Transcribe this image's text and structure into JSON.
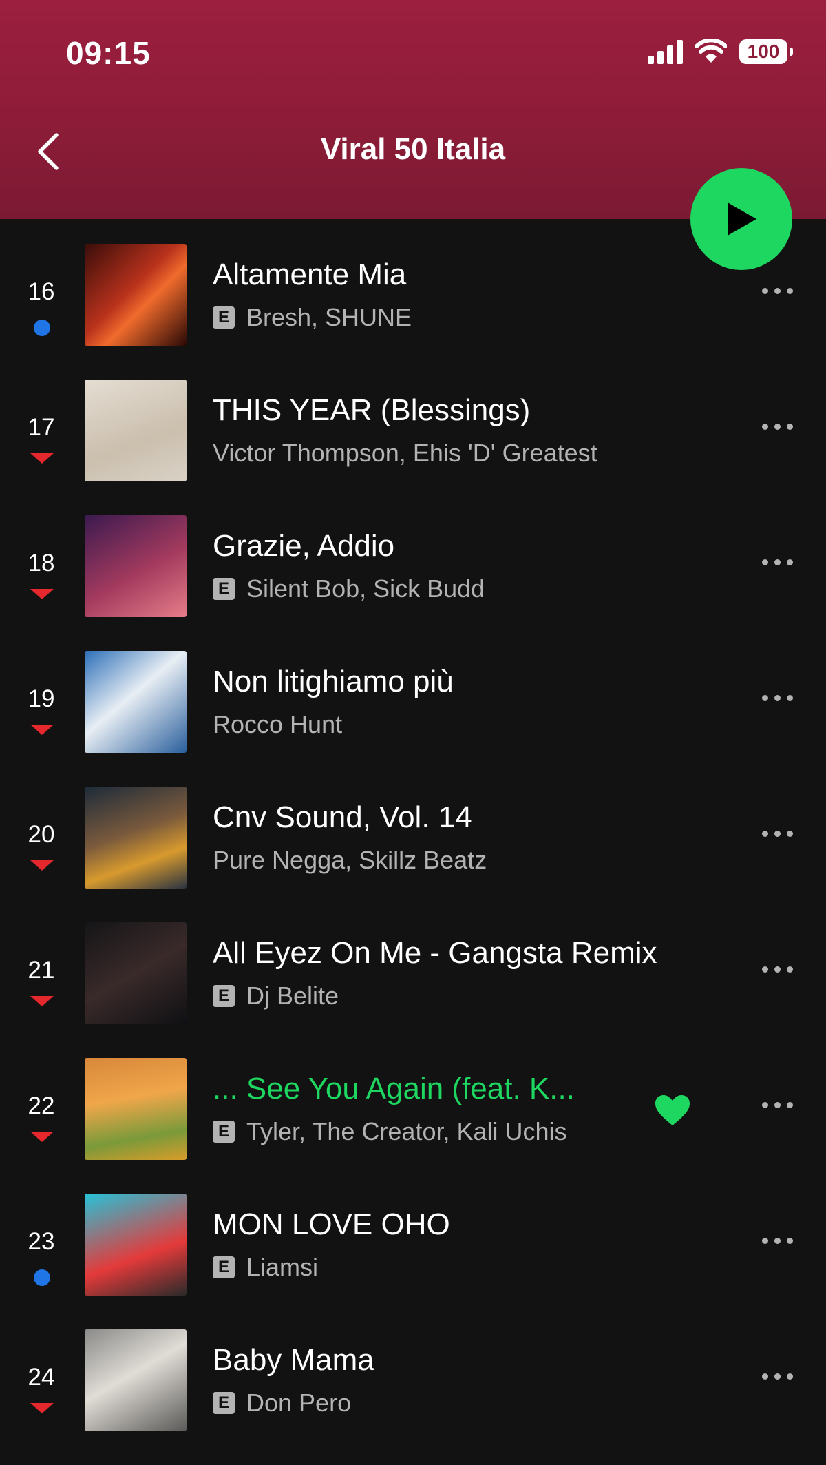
{
  "status_bar": {
    "time": "09:15",
    "battery": "100"
  },
  "header": {
    "title": "Viral 50 Italia"
  },
  "colors": {
    "accent_green": "#1ed760",
    "header_red": "#8d1c38",
    "trend_down": "#e5282d",
    "trend_new": "#1f74e6"
  },
  "tracks": [
    {
      "rank": "16",
      "title": "Altamente Mia",
      "artists": "Bresh, SHUNE",
      "explicit": true,
      "trend": "new",
      "playing": false,
      "liked": false
    },
    {
      "rank": "17",
      "title": "THIS YEAR (Blessings)",
      "artists": "Victor Thompson, Ehis 'D' Greatest",
      "explicit": false,
      "trend": "down",
      "playing": false,
      "liked": false
    },
    {
      "rank": "18",
      "title": "Grazie, Addio",
      "artists": "Silent Bob, Sick Budd",
      "explicit": true,
      "trend": "down",
      "playing": false,
      "liked": false
    },
    {
      "rank": "19",
      "title": "Non litighiamo più",
      "artists": "Rocco Hunt",
      "explicit": false,
      "trend": "down",
      "playing": false,
      "liked": false
    },
    {
      "rank": "20",
      "title": "Cnv Sound, Vol. 14",
      "artists": "Pure Negga, Skillz Beatz",
      "explicit": false,
      "trend": "down",
      "playing": false,
      "liked": false
    },
    {
      "rank": "21",
      "title": "All Eyez On Me - Gangsta Remix",
      "artists": "Dj Belite",
      "explicit": true,
      "trend": "down",
      "playing": false,
      "liked": false
    },
    {
      "rank": "22",
      "title": "... See You Again (feat. K...",
      "artists": "Tyler, The Creator, Kali Uchis",
      "explicit": true,
      "trend": "down",
      "playing": true,
      "liked": true
    },
    {
      "rank": "23",
      "title": "MON LOVE OHO",
      "artists": "Liamsi",
      "explicit": true,
      "trend": "new",
      "playing": false,
      "liked": false
    },
    {
      "rank": "24",
      "title": "Baby Mama",
      "artists": "Don Pero",
      "explicit": true,
      "trend": "down",
      "playing": false,
      "liked": false
    }
  ]
}
